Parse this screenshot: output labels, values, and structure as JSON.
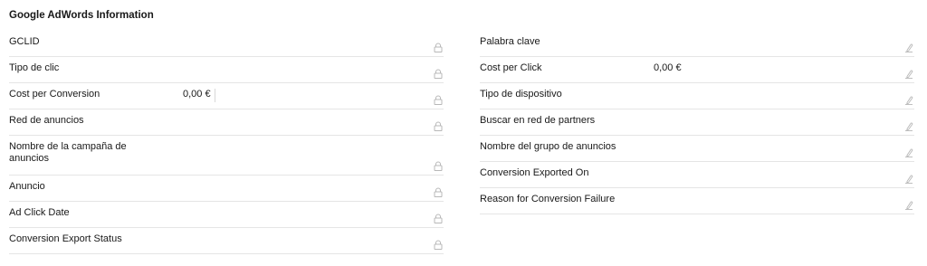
{
  "section": {
    "title": "Google AdWords Information"
  },
  "left_fields": [
    {
      "label": "GCLID",
      "value": "",
      "icon": "lock-icon"
    },
    {
      "label": "Tipo de clic",
      "value": "",
      "icon": "lock-icon"
    },
    {
      "label": "Cost per Conversion",
      "value": "0,00 €",
      "icon": "lock-icon"
    },
    {
      "label": "Red de anuncios",
      "value": "",
      "icon": "lock-icon"
    },
    {
      "label": "Nombre de la campaña de anuncios",
      "value": "",
      "icon": "lock-icon"
    },
    {
      "label": "Anuncio",
      "value": "",
      "icon": "lock-icon"
    },
    {
      "label": "Ad Click Date",
      "value": "",
      "icon": "lock-icon"
    },
    {
      "label": "Conversion Export Status",
      "value": "",
      "icon": "lock-icon"
    }
  ],
  "right_fields": [
    {
      "label": "Palabra clave",
      "value": "",
      "icon": "edit-icon"
    },
    {
      "label": "Cost per Click",
      "value": "0,00 €",
      "icon": "edit-icon"
    },
    {
      "label": "Tipo de dispositivo",
      "value": "",
      "icon": "edit-icon"
    },
    {
      "label": "Buscar en red de partners",
      "value": "",
      "icon": "edit-icon"
    },
    {
      "label": "Nombre del grupo de anuncios",
      "value": "",
      "icon": "edit-icon"
    },
    {
      "label": "Conversion Exported On",
      "value": "",
      "icon": "edit-icon"
    },
    {
      "label": "Reason for Conversion Failure",
      "value": "",
      "icon": "edit-icon"
    }
  ],
  "colors": {
    "text": "#181818",
    "divider": "#e5e5e5",
    "icon": "#b8b8b8"
  }
}
